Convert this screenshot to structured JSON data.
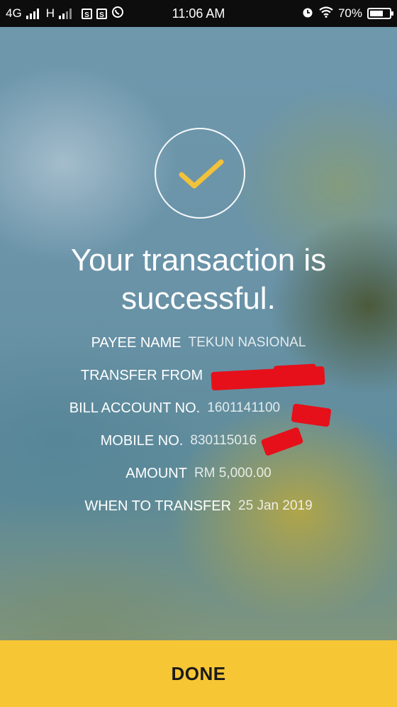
{
  "status_bar": {
    "network_1": "4G",
    "network_2": "H",
    "notif_1": "S",
    "notif_2": "S",
    "time": "11:06 AM",
    "battery_percent": "70%",
    "battery_level": 0.7
  },
  "success": {
    "headline_line1": "Your transaction is",
    "headline_line2": "successful."
  },
  "details": [
    {
      "label": "PAYEE NAME",
      "value": "TEKUN NASIONAL"
    },
    {
      "label": "TRANSFER FROM",
      "value": ""
    },
    {
      "label": "BILL ACCOUNT NO.",
      "value": "1601141100"
    },
    {
      "label": "MOBILE NO.",
      "value": "830115016"
    },
    {
      "label": "AMOUNT",
      "value": "RM 5,000.00"
    },
    {
      "label": "WHEN TO TRANSFER",
      "value": "25 Jan 2019"
    }
  ],
  "done_button": {
    "label": "DONE"
  },
  "colors": {
    "accent": "#f7c634",
    "check": "#f2c23a",
    "redaction": "#e5101a"
  }
}
